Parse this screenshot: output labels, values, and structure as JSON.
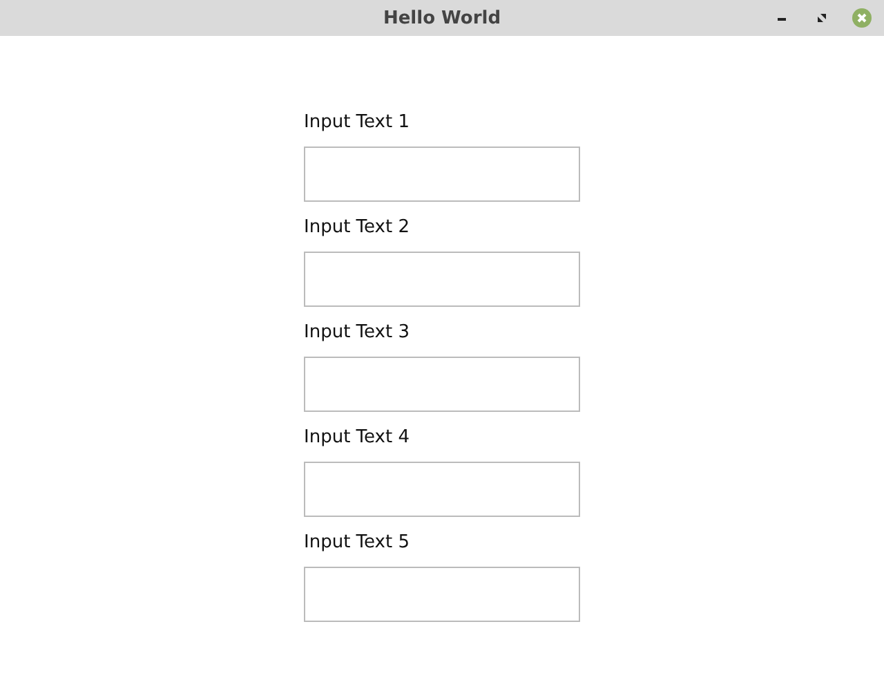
{
  "window": {
    "title": "Hello World"
  },
  "fields": [
    {
      "label": "Input Text 1"
    },
    {
      "label": "Input Text 2"
    },
    {
      "label": "Input Text 3"
    },
    {
      "label": "Input Text 4"
    },
    {
      "label": "Input Text 5"
    }
  ]
}
